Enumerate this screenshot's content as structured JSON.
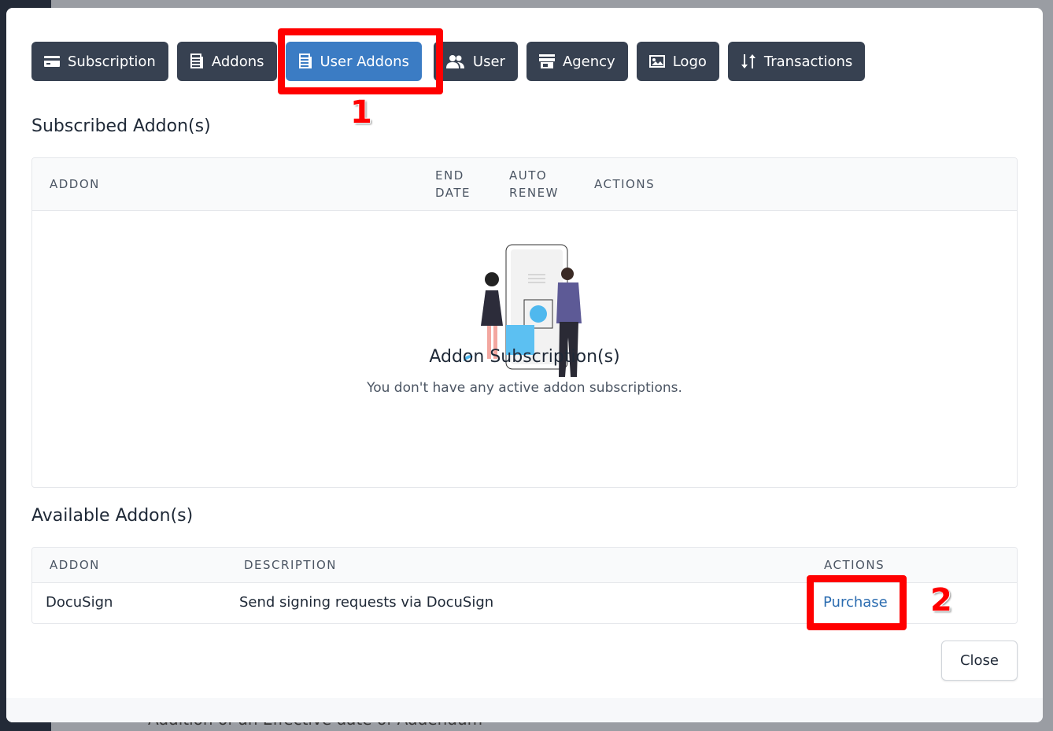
{
  "background": {
    "text": "Addition of an Effective date of Addendum"
  },
  "tabs": [
    {
      "label": "Subscription",
      "icon": "credit-card-icon"
    },
    {
      "label": "Addons",
      "icon": "stack-icon"
    },
    {
      "label": "User Addons",
      "icon": "stack-icon",
      "active": true
    },
    {
      "label": "User",
      "icon": "users-icon"
    },
    {
      "label": "Agency",
      "icon": "store-icon"
    },
    {
      "label": "Logo",
      "icon": "image-icon"
    },
    {
      "label": "Transactions",
      "icon": "sort-arrows-icon"
    }
  ],
  "annotations": {
    "one": "1",
    "two": "2",
    "color": "#ff0000"
  },
  "subscribed": {
    "title": "Subscribed Addon(s)",
    "columns": [
      "ADDON",
      "END DATE",
      "AUTO RENEW",
      "ACTIONS"
    ],
    "empty_title": "Addon Subscription(s)",
    "empty_text": "You don't have any active addon subscriptions."
  },
  "available": {
    "title": "Available Addon(s)",
    "columns": [
      "ADDON",
      "DESCRIPTION",
      "ACTIONS"
    ],
    "rows": [
      {
        "addon": "DocuSign",
        "description": "Send signing requests via DocuSign",
        "action": "Purchase"
      }
    ]
  },
  "close_label": "Close",
  "colors": {
    "active_tab": "#3b7cc4",
    "tab": "#374151",
    "link": "#2b6cb0"
  }
}
